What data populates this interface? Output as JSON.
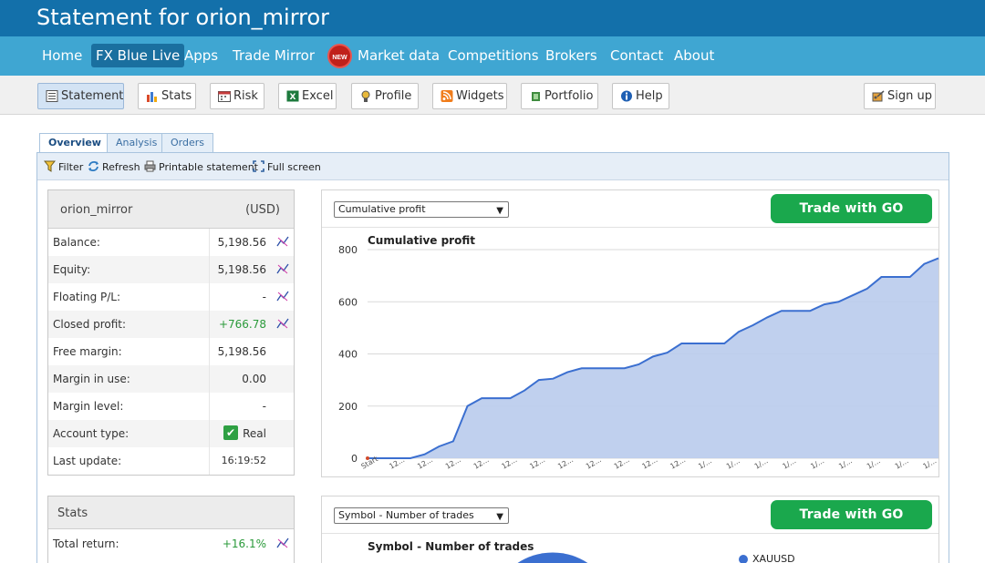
{
  "header": {
    "title": "Statement for orion_mirror"
  },
  "nav": {
    "items": [
      {
        "label": "Home"
      },
      {
        "label": "FX Blue Live"
      },
      {
        "label": "Apps"
      },
      {
        "label": "Trade Mirror"
      },
      {
        "label": "Market data",
        "badge": "NEW"
      },
      {
        "label": "Competitions"
      },
      {
        "label": "Brokers"
      },
      {
        "label": "Contact"
      },
      {
        "label": "About"
      }
    ]
  },
  "toolbar": {
    "buttons": [
      {
        "label": "Statement"
      },
      {
        "label": "Stats"
      },
      {
        "label": "Risk"
      },
      {
        "label": "Excel"
      },
      {
        "label": "Profile"
      },
      {
        "label": "Widgets"
      },
      {
        "label": "Portfolio"
      },
      {
        "label": "Help"
      }
    ],
    "signup": "Sign up"
  },
  "tabs": [
    {
      "label": "Overview"
    },
    {
      "label": "Analysis"
    },
    {
      "label": "Orders"
    }
  ],
  "subtoolbar": {
    "filter": "Filter",
    "refresh": "Refresh",
    "printable": "Printable statement",
    "fullscreen": "Full screen"
  },
  "account": {
    "name": "orion_mirror",
    "currency": "(USD)",
    "rows": [
      {
        "label": "Balance:",
        "value": "5,198.56"
      },
      {
        "label": "Equity:",
        "value": "5,198.56"
      },
      {
        "label": "Floating P/L:",
        "value": "-"
      },
      {
        "label": "Closed profit:",
        "value": "+766.78"
      },
      {
        "label": "Free margin:",
        "value": "5,198.56"
      },
      {
        "label": "Margin in use:",
        "value": "0.00"
      },
      {
        "label": "Margin level:",
        "value": "-"
      },
      {
        "label": "Account type:",
        "value": "Real"
      },
      {
        "label": "Last update:",
        "value": "16:19:52"
      }
    ]
  },
  "stats": {
    "title": "Stats",
    "rows": [
      {
        "label": "Total return:",
        "value": "+16.1%"
      }
    ]
  },
  "chart1": {
    "select": "Cumulative profit",
    "cta": "Trade with GO Markets",
    "title": "Cumulative profit"
  },
  "chart2": {
    "select": "Symbol - Number of trades",
    "cta": "Trade with GO Markets",
    "title": "Symbol - Number of trades",
    "legend": "XAUUSD"
  },
  "colors": {
    "header": "#1370aa",
    "nav": "#3fa6d2",
    "cta": "#1aa84d",
    "line": "#3b6fd0",
    "area": "#b9cbec",
    "positive": "#2a9a3a"
  },
  "chart_data": {
    "type": "area",
    "title": "Cumulative profit",
    "ylim": [
      0,
      800
    ],
    "yticks": [
      0,
      200,
      400,
      600,
      800
    ],
    "grid": true,
    "xtick_labels": [
      "Start",
      "12...",
      "12...",
      "12...",
      "12...",
      "12...",
      "12...",
      "12...",
      "12...",
      "12...",
      "12...",
      "12...",
      "1/...",
      "1/...",
      "1/...",
      "1/...",
      "1/...",
      "1/...",
      "1/...",
      "1/...",
      "1/..."
    ],
    "values": [
      0,
      0,
      0,
      0,
      15,
      45,
      65,
      200,
      230,
      230,
      230,
      260,
      300,
      305,
      330,
      345,
      345,
      345,
      345,
      360,
      390,
      405,
      440,
      440,
      440,
      440,
      485,
      510,
      540,
      565,
      565,
      565,
      590,
      600,
      625,
      650,
      695,
      695,
      695,
      745,
      767
    ]
  }
}
